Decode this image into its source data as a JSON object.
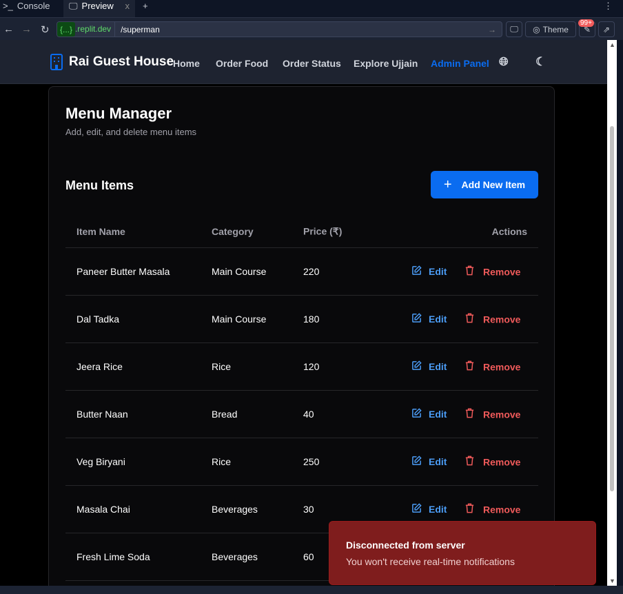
{
  "browser": {
    "tabs": [
      {
        "label": "Console",
        "icon": "terminal-icon"
      },
      {
        "label": "Preview",
        "icon": "monitor-icon"
      }
    ],
    "close": "x",
    "new_tab": "+",
    "menu": "⋮",
    "domain_badge": "{...}",
    "domain": ".replit.dev",
    "path": "/superman",
    "theme_label": "Theme",
    "notif_badge": "99+"
  },
  "nav": {
    "brand": "Rai Guest House",
    "links": [
      "Home",
      "Order Food",
      "Order Status",
      "Explore Ujjain",
      "Admin Panel"
    ],
    "active": "Admin Panel",
    "accent": "#0a6cf0"
  },
  "manager": {
    "title": "Menu Manager",
    "subtitle": "Add, edit, and delete menu items",
    "section": "Menu Items",
    "add_label": "Add New Item",
    "columns": [
      "Item Name",
      "Category",
      "Price (₹)",
      "Actions"
    ],
    "rows": [
      {
        "name": "Paneer Butter Masala",
        "category": "Main Course",
        "price": "220"
      },
      {
        "name": "Dal Tadka",
        "category": "Main Course",
        "price": "180"
      },
      {
        "name": "Jeera Rice",
        "category": "Rice",
        "price": "120"
      },
      {
        "name": "Butter Naan",
        "category": "Bread",
        "price": "40"
      },
      {
        "name": "Veg Biryani",
        "category": "Rice",
        "price": "250"
      },
      {
        "name": "Masala Chai",
        "category": "Beverages",
        "price": "30"
      },
      {
        "name": "Fresh Lime Soda",
        "category": "Beverages",
        "price": "60"
      }
    ],
    "edit_label": "Edit",
    "remove_label": "Remove"
  },
  "toast": {
    "title": "Disconnected from server",
    "message": "You won't receive real-time notifications",
    "color": "#7f1d1d"
  }
}
